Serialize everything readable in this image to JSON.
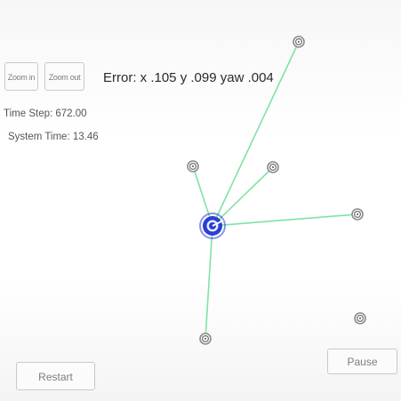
{
  "toolbar": {
    "zoom_in_label": "Zoom in",
    "zoom_out_label": "Zoom out"
  },
  "status": {
    "error_text": "Error: x .105 y .099 yaw .004",
    "time_step_text": "Time Step: 672.00",
    "system_time_text": "System Time: 13.46"
  },
  "controls": {
    "restart_label": "Restart",
    "pause_label": "Pause"
  },
  "colors": {
    "robot": "#2a3fd6",
    "landmark_link": "#7ee3a2",
    "landmark": "#8a8a8a"
  },
  "icons": {
    "robot": "robot-icon",
    "landmark": "landmark-icon"
  }
}
